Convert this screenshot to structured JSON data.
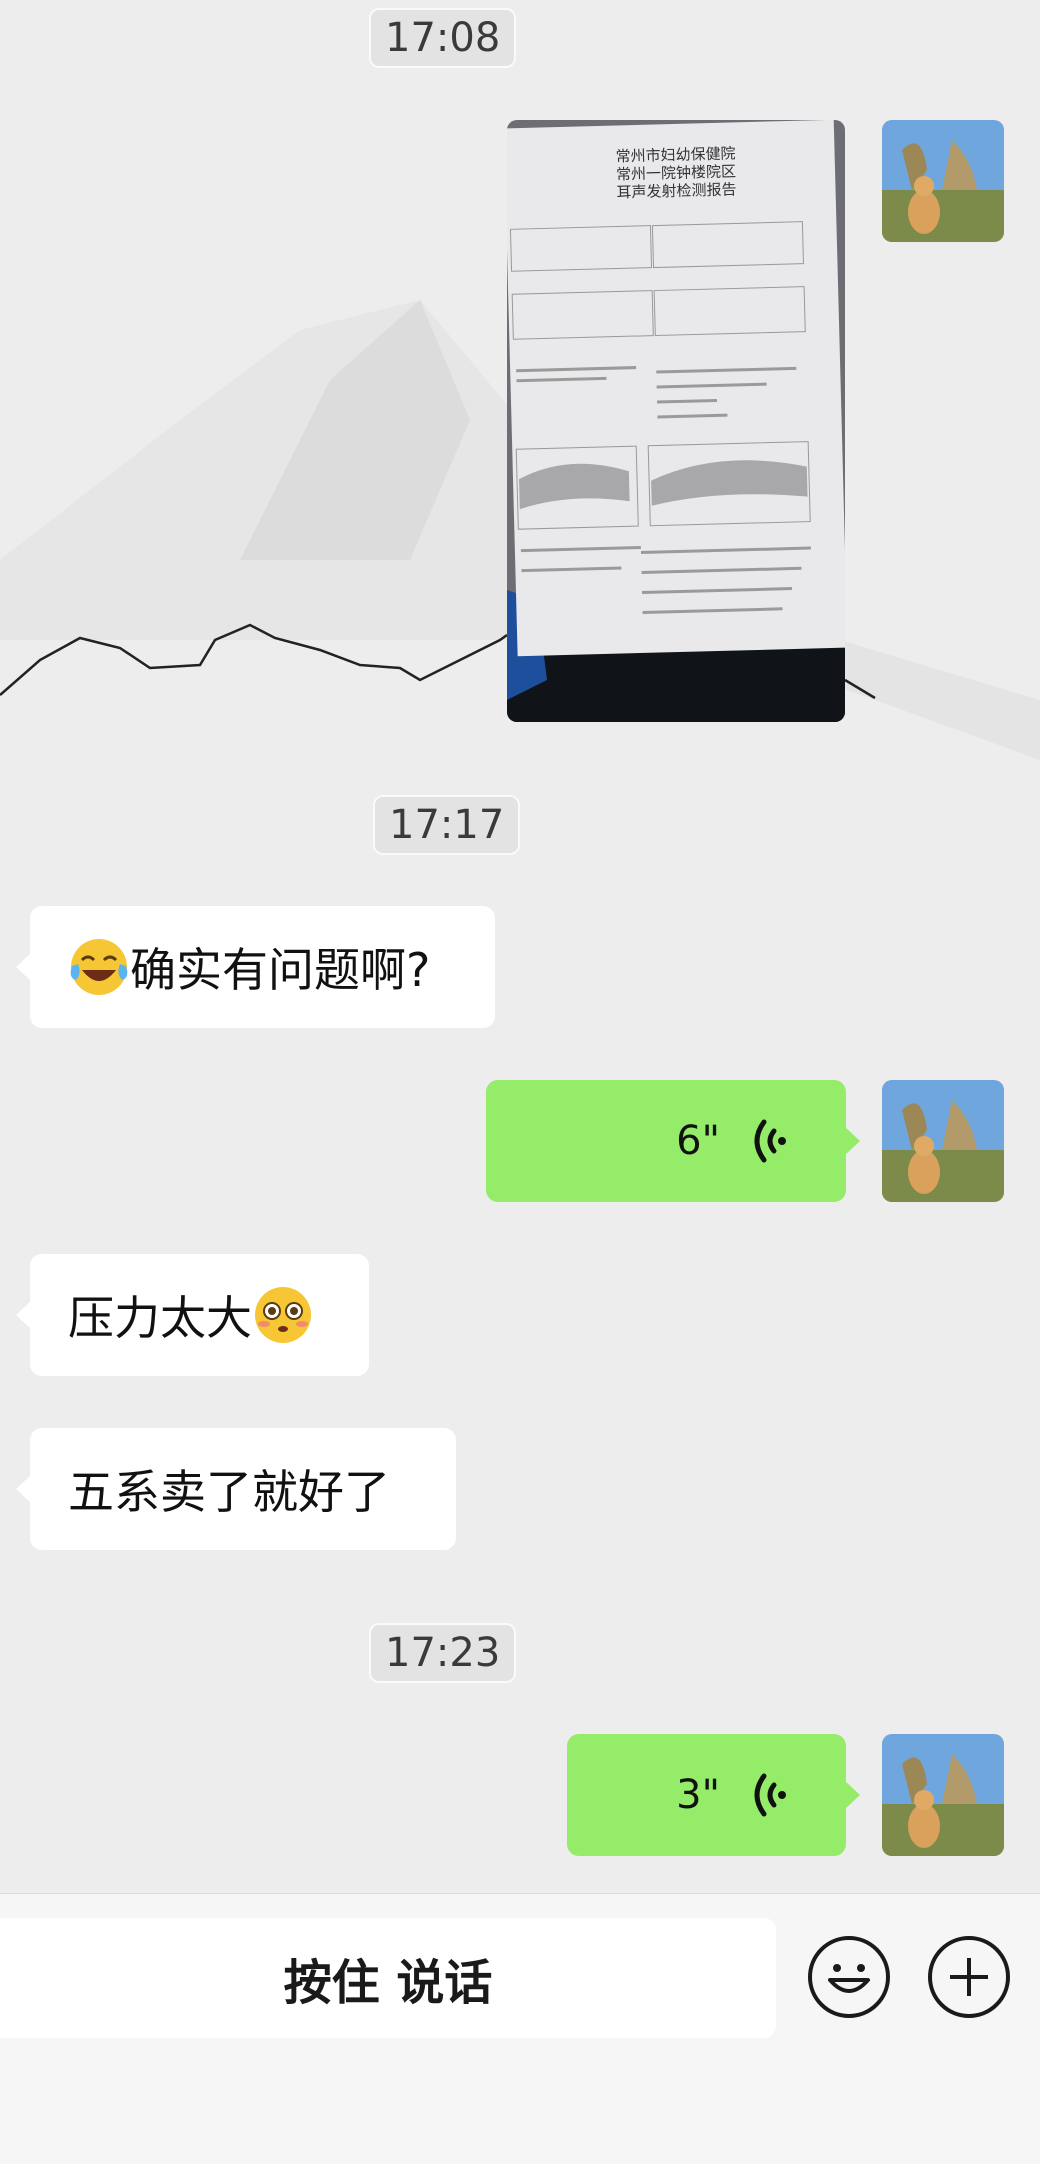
{
  "colors": {
    "background": "#ededed",
    "incoming_bubble": "#ffffff",
    "outgoing_bubble": "#95ec69",
    "text": "#111111"
  },
  "timestamps": [
    "17:08",
    "17:17",
    "17:23"
  ],
  "image_message": {
    "sender": "me",
    "header_line_1": "常州市妇幼保健院",
    "header_line_2": "常州一院钟楼院区",
    "header_line_3": "耳声发射检测报告"
  },
  "messages": [
    {
      "side": "left",
      "emoji": "face-with-tears-of-joy-emoji",
      "text": "确实有问题啊?"
    },
    {
      "side": "right",
      "type": "voice",
      "duration": "6\""
    },
    {
      "side": "left",
      "emoji_after": "flushed-face-emoji",
      "text": "压力太大"
    },
    {
      "side": "left",
      "text": "五系卖了就好了"
    },
    {
      "side": "right",
      "type": "voice",
      "duration": "3\""
    }
  ],
  "input_bar": {
    "hold_to_talk_label": "按住 说话",
    "emoji_icon": "smiley-face-icon",
    "plus_icon": "plus-circle-icon"
  }
}
